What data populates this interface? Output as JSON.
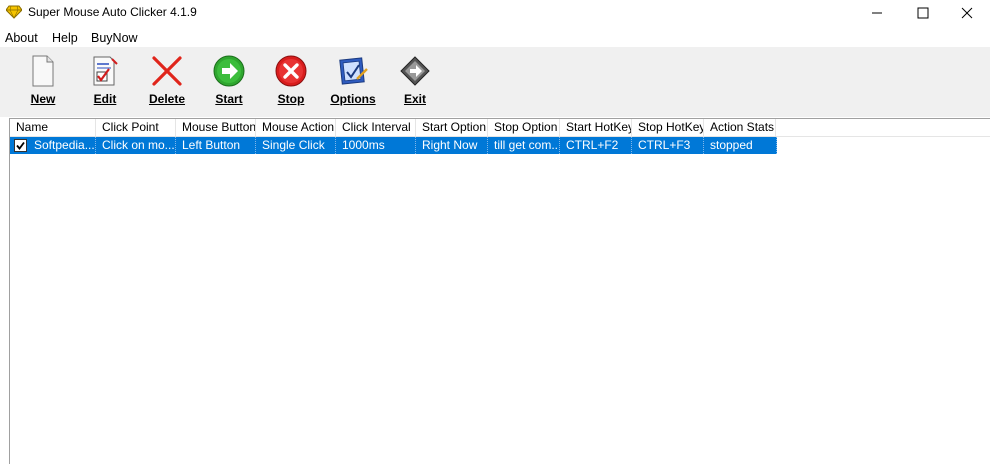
{
  "window": {
    "title": "Super Mouse Auto Clicker 4.1.9"
  },
  "menu": {
    "items": [
      "About",
      "Help",
      "BuyNow"
    ]
  },
  "toolbar": {
    "buttons": [
      {
        "label": "New",
        "icon": "new-document-icon"
      },
      {
        "label": "Edit",
        "icon": "edit-document-icon"
      },
      {
        "label": "Delete",
        "icon": "delete-x-icon"
      },
      {
        "label": "Start",
        "icon": "start-arrow-icon"
      },
      {
        "label": "Stop",
        "icon": "stop-x-icon"
      },
      {
        "label": "Options",
        "icon": "options-checklist-icon"
      },
      {
        "label": "Exit",
        "icon": "exit-icon"
      }
    ]
  },
  "list": {
    "columns": [
      "Name",
      "Click Point",
      "Mouse Button",
      "Mouse Action",
      "Click Interval",
      "Start Option",
      "Stop Option",
      "Start HotKey",
      "Stop HotKey",
      "Action Stats"
    ],
    "rows": [
      {
        "checked": true,
        "selected": true,
        "cells": [
          "Softpedia...",
          "Click on mo...",
          "Left Button",
          "Single Click",
          "1000ms",
          "Right Now",
          "till get com...",
          "CTRL+F2",
          "CTRL+F3",
          "stopped"
        ]
      }
    ]
  },
  "colors": {
    "selection": "#0078d7",
    "toolbar_bg": "#f0f0f0"
  }
}
